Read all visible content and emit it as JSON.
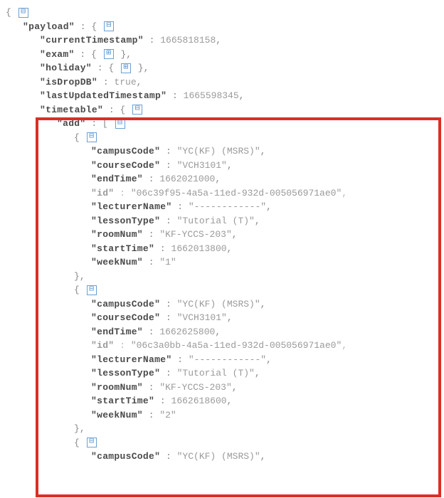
{
  "root": {
    "openBrace": "{",
    "closeBrace": "}",
    "payloadKey": "\"payload\"",
    "colon": " : ",
    "comma": ",",
    "toggleMinus": "⊟",
    "togglePlus": "⊞",
    "currentTimestampKey": "\"currentTimestamp\"",
    "currentTimestampVal": "1665818158",
    "examKey": "\"exam\"",
    "holidayKey": "\"holiday\"",
    "isDropDBKey": "\"isDropDB\"",
    "isDropDBVal": "true",
    "lastUpdatedTimestampKey": "\"lastUpdatedTimestamp\"",
    "lastUpdatedTimestampVal": "1665598345",
    "timetableKey": "\"timetable\"",
    "addKey": "\"add\"",
    "openBracket": "[",
    "closeBracket": "]",
    "campusCodeKey": "\"campusCode\"",
    "courseCodeKey": "\"courseCode\"",
    "endTimeKey": "\"endTime\"",
    "idKey": "\"id\"",
    "lecturerNameKey": "\"lecturerName\"",
    "lessonTypeKey": "\"lessonType\"",
    "roomNumKey": "\"roomNum\"",
    "startTimeKey": "\"startTime\"",
    "weekNumKey": "\"weekNum\""
  },
  "items": [
    {
      "campusCode": "\"YC(KF) (MSRS)\"",
      "courseCode": "\"VCH3101\"",
      "endTime": "1662021000",
      "id": "\"06c39f95-4a5a-11ed-932d-005056971ae0\"",
      "lecturerName": "\"------------\"",
      "lessonType": "\"Tutorial (T)\"",
      "roomNum": "\"KF-YCCS-203\"",
      "startTime": "1662013800",
      "weekNum": "\"1\""
    },
    {
      "campusCode": "\"YC(KF) (MSRS)\"",
      "courseCode": "\"VCH3101\"",
      "endTime": "1662625800",
      "id": "\"06c3a0bb-4a5a-11ed-932d-005056971ae0\"",
      "lecturerName": "\"------------\"",
      "lessonType": "\"Tutorial (T)\"",
      "roomNum": "\"KF-YCCS-203\"",
      "startTime": "1662618600",
      "weekNum": "\"2\""
    },
    {
      "campusCode": "\"YC(KF) (MSRS)\""
    }
  ]
}
